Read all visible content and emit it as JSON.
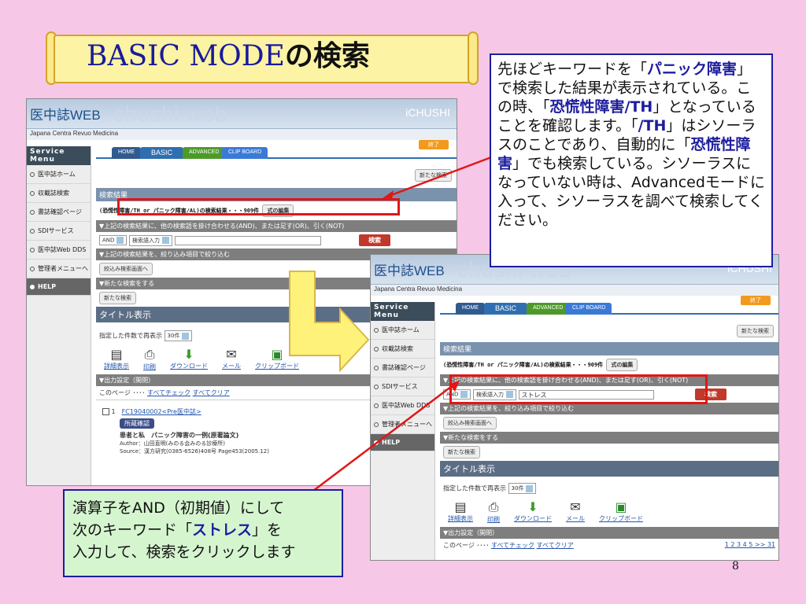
{
  "slide": {
    "title_latin": "BASIC MODE",
    "title_jp": "の検索",
    "page_number": "8"
  },
  "screen": {
    "logo": "医中誌WEB",
    "ghost_logo": "chushi web",
    "brand": "iCHUSHI",
    "subtitle": "Japana Centra Revuo Medicina",
    "menu_head": "Service Menu",
    "menu_items": [
      "医中誌ホーム",
      "収載誌検索",
      "書誌確認ページ",
      "SDIサービス",
      "医中誌Web DDS",
      "管理者メニューへ",
      "HELP"
    ],
    "tabs": {
      "home": "HOME",
      "basic": "BASIC",
      "advanced": "ADVANCED",
      "clip": "CLIP BOARD",
      "end": "終了"
    },
    "new_search_btn": "新たな検索",
    "results_bar": "検索結果",
    "summary": "(恐慌性障害/TH or パニック障害/AL)の検索結果・・・909件",
    "edit_formula": "式の編集",
    "combine_bar": "▼上記の検索結果に、他の検索語を掛け合わせる(AND)、または足す(OR)、引く(NOT)",
    "operator": "AND",
    "field": "検索語入力",
    "keyword": "ストレス",
    "search_btn": "検索",
    "narrow_bar": "▼上記の検索結果を、絞り込み項目で絞り込む",
    "narrow_btn": "絞込み検索画面へ",
    "new_bar": "▼新たな検索をする",
    "new_btn": "新たな検索",
    "title_display": "タイトル表示",
    "redisplay_label": "指定した件数で再表示",
    "count_option": "30件",
    "icons": [
      "詳細表示",
      "印刷",
      "ダウンロード",
      "メール",
      "クリップボード"
    ],
    "output_bar": "▼出力設定（開閉）",
    "page_links_prefix": "このページ ････",
    "check_all": "すべてチェック",
    "clear_all": "すべてクリア",
    "pagination": "1 2 3 4 5 >> 31",
    "record": {
      "index": "1",
      "id": "FC19040002<Pre医中誌>",
      "holding": "所蔵確認",
      "title": "患者と私　パニック障害の一例(原著論文)",
      "author": "Author：山田直明(みのる会みのる診療所)",
      "source": "Source：漢方研究(0385-6526)408号 Page453(2005.12)"
    }
  },
  "callout_top": {
    "p1": "先ほどキーワードを「",
    "k1": "パニック障害",
    "p2": "」で検索した結果が表示されている。この時、「",
    "k2": "恐慌性障害/TH",
    "p3": "」となっていることを確認します。「",
    "k3": "/TH",
    "p4": "」はシソーラスのことであり、自動的に「",
    "k4": "恐慌性障害",
    "p5": "」でも検索している。シソーラスになっていない時は、Advancedモードに入って、シソーラスを調べて検索してください。"
  },
  "callout_bottom": {
    "line1": "演算子をAND（初期値）にして",
    "line2a": "次のキーワード「",
    "line2k": "ストレス",
    "line2b": "」を",
    "line3": "入力して、検索をクリックします"
  },
  "colors": {
    "background": "#f7c7e8",
    "highlight": "#1d1d9e",
    "red": "#e21616",
    "arrow_yellow": "#fff27a"
  }
}
